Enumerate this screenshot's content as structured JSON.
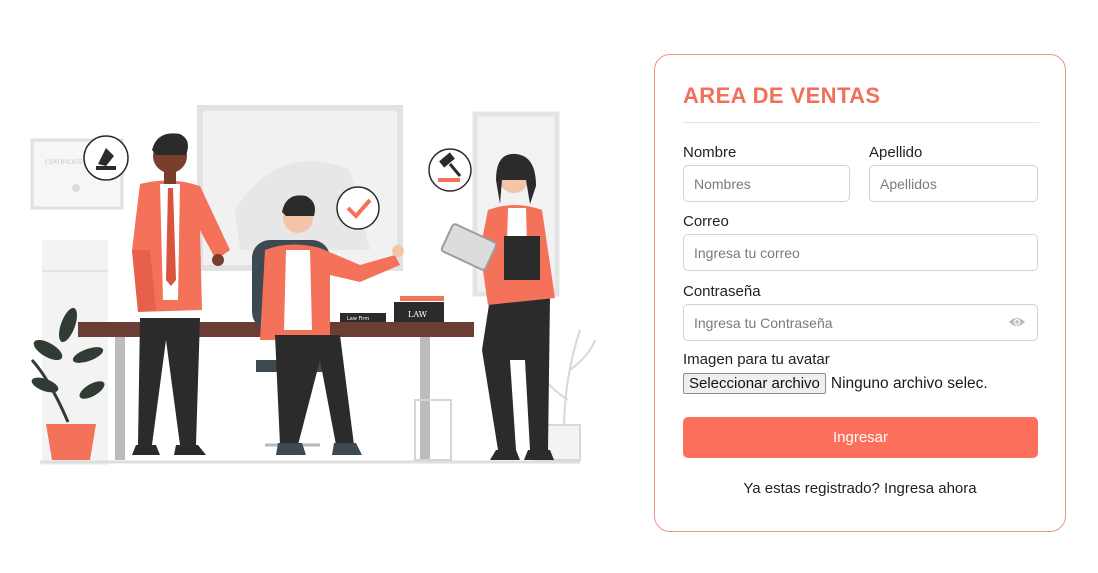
{
  "illustration": {
    "name": "office-team-illustration",
    "desk_sign": "Law Firm",
    "book_label": "LAW",
    "certificate_label": "CERTIFICATE"
  },
  "form": {
    "title": "AREA DE VENTAS",
    "first_name_label": "Nombre",
    "first_name_placeholder": "Nombres",
    "last_name_label": "Apellido",
    "last_name_placeholder": "Apellidos",
    "email_label": "Correo",
    "email_placeholder": "Ingresa tu correo",
    "password_label": "Contraseña",
    "password_placeholder": "Ingresa tu Contraseña",
    "avatar_label": "Imagen para tu avatar",
    "file_button_label": "Seleccionar archivo",
    "file_status": "Ninguno archivo selec.",
    "submit_label": "Ingresar",
    "footer_text": "Ya estas registrado?",
    "footer_link": "Ingresa ahora"
  },
  "colors": {
    "accent": "#fb6f5b",
    "title": "#f2705a",
    "card_border": "#f0938a",
    "jacket": "#f4715a",
    "dark": "#2b2b2b"
  }
}
